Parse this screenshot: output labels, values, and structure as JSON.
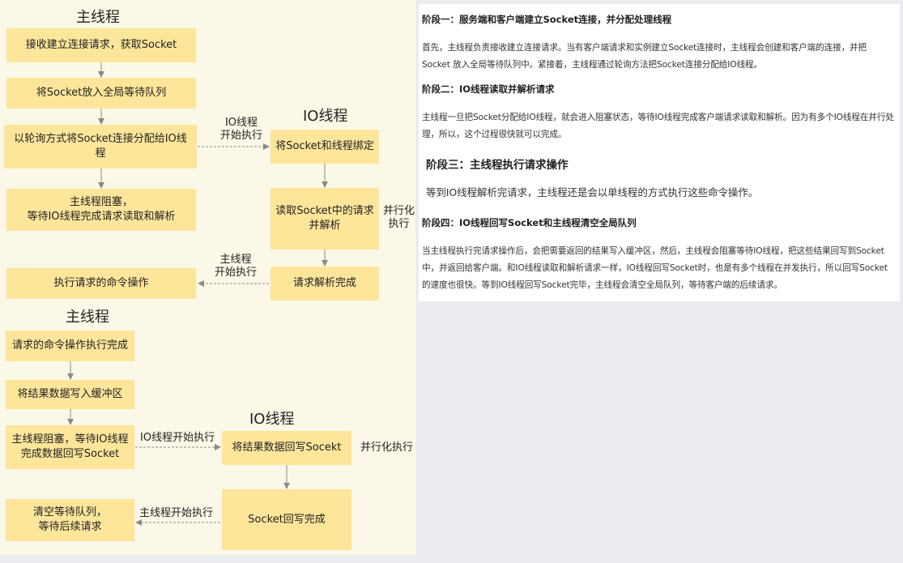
{
  "diagram1": {
    "main_title": "主线程",
    "io_title": "IO线程",
    "steps": {
      "s1": "接收建立连接请求，获取Socket",
      "s2": "将Socket放入全局等待队列",
      "s3": "以轮询方式将Socket连接分配给IO线程",
      "s4": "主线程阻塞，\n等待IO线程完成请求读取和解析",
      "s5": "执行请求的命令操作",
      "io1": "将Socket和线程绑定",
      "io2": "读取Socket中的请求\n并解析",
      "io3": "请求解析完成"
    },
    "labels": {
      "to_io": "IO线程\n开始执行",
      "parallel": "并行化\n执行",
      "to_main": "主线程\n开始执行"
    }
  },
  "diagram2": {
    "main_title": "主线程",
    "io_title": "IO线程",
    "steps": {
      "s1": "请求的命令操作执行完成",
      "s2": "将结果数据写入缓冲区",
      "s3": "主线程阻塞，等待IO线程\n完成数据回写Socket",
      "s4": "清空等待队列，\n等待后续请求",
      "io1": "将结果数据回写Socekt",
      "io2": "Socket回写完成"
    },
    "labels": {
      "to_io": "IO线程开始执行",
      "parallel": "并行化执行",
      "to_main": "主线程开始执行"
    }
  },
  "text": {
    "h1": "阶段一：服务端和客户端建立Socket连接，并分配处理线程",
    "p1": "首先，主线程负责接收建立连接请求。当有客户端请求和实例建立Socket连接时，主线程会创建和客户端的连接，并把 Socket 放入全局等待队列中。紧接着，主线程通过轮询方法把Socket连接分配给IO线程。",
    "h2": "阶段二：IO线程读取并解析请求",
    "p2": "主线程一旦把Socket分配给IO线程，就会进入阻塞状态，等待IO线程完成客户端请求读取和解析。因为有多个IO线程在并行处理，所以，这个过程很快就可以完成。",
    "h3": "阶段三：主线程执行请求操作",
    "p3": "等到IO线程解析完请求，主线程还是会以单线程的方式执行这些命令操作。",
    "h4": "阶段四：IO线程回写Socket和主线程清空全局队列",
    "p4": "当主线程执行完请求操作后，会把需要返回的结果写入缓冲区，然后，主线程会阻塞等待IO线程，把这些结果回写到Socket中，并返回给客户端。和IO线程读取和解析请求一样，IO线程回写Socket时，也是有多个线程在并发执行，所以回写Socket的速度也很快。等到IO线程回写Socket完毕，主线程会清空全局队列，等待客户端的后续请求。"
  },
  "colors": {
    "box": "#fde59a",
    "panel": "#fbf8e8",
    "arrow": "#8a8a8a",
    "background": "#eaecf0"
  }
}
